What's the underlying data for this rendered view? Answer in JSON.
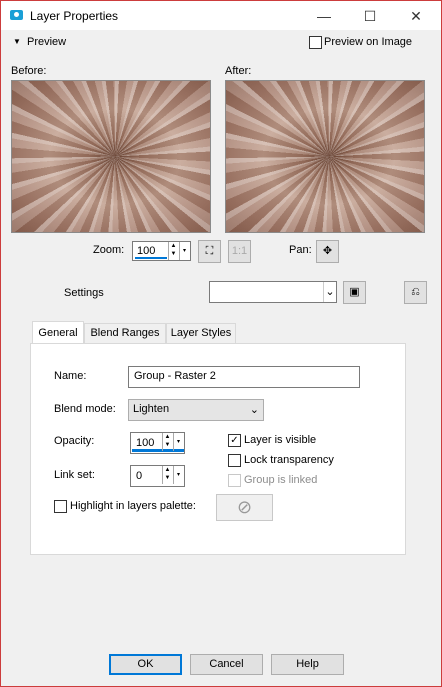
{
  "window": {
    "title": "Layer Properties",
    "min": "—",
    "max": "☐",
    "close": "✕"
  },
  "preview": {
    "toggle_label": "Preview",
    "on_image_label": "Preview on Image",
    "before_label": "Before:",
    "after_label": "After:",
    "zoom_label": "Zoom:",
    "zoom_value": "100",
    "pan_label": "Pan:"
  },
  "settings": {
    "label": "Settings",
    "preset_value": ""
  },
  "tabs": [
    "General",
    "Blend Ranges",
    "Layer Styles"
  ],
  "general": {
    "name_label": "Name:",
    "name_value": "Group - Raster 2",
    "blend_label": "Blend mode:",
    "blend_value": "Lighten",
    "opacity_label": "Opacity:",
    "opacity_value": "100",
    "linkset_label": "Link set:",
    "linkset_value": "0",
    "visible_label": "Layer is visible",
    "visible_checked": true,
    "lock_label": "Lock transparency",
    "lock_checked": false,
    "linked_label": "Group is linked",
    "highlight_label": "Highlight in layers palette:"
  },
  "buttons": {
    "ok": "OK",
    "cancel": "Cancel",
    "help": "Help"
  },
  "colors": {
    "accent": "#0078d7",
    "frame": "#cc3c3c",
    "app_icon": "#1a9fd6"
  }
}
